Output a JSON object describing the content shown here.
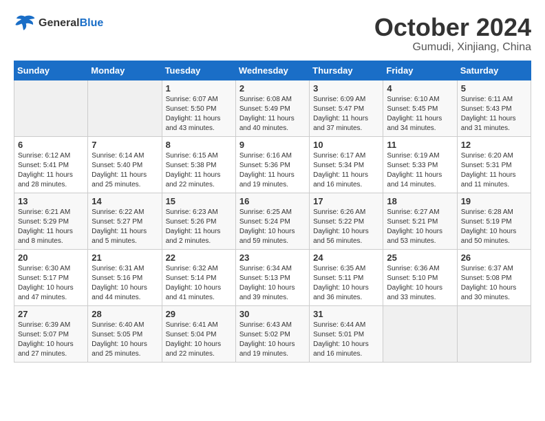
{
  "header": {
    "logo_line1": "General",
    "logo_line2": "Blue",
    "month": "October 2024",
    "location": "Gumudi, Xinjiang, China"
  },
  "days_of_week": [
    "Sunday",
    "Monday",
    "Tuesday",
    "Wednesday",
    "Thursday",
    "Friday",
    "Saturday"
  ],
  "weeks": [
    [
      {
        "num": "",
        "info": ""
      },
      {
        "num": "",
        "info": ""
      },
      {
        "num": "1",
        "info": "Sunrise: 6:07 AM\nSunset: 5:50 PM\nDaylight: 11 hours and 43 minutes."
      },
      {
        "num": "2",
        "info": "Sunrise: 6:08 AM\nSunset: 5:49 PM\nDaylight: 11 hours and 40 minutes."
      },
      {
        "num": "3",
        "info": "Sunrise: 6:09 AM\nSunset: 5:47 PM\nDaylight: 11 hours and 37 minutes."
      },
      {
        "num": "4",
        "info": "Sunrise: 6:10 AM\nSunset: 5:45 PM\nDaylight: 11 hours and 34 minutes."
      },
      {
        "num": "5",
        "info": "Sunrise: 6:11 AM\nSunset: 5:43 PM\nDaylight: 11 hours and 31 minutes."
      }
    ],
    [
      {
        "num": "6",
        "info": "Sunrise: 6:12 AM\nSunset: 5:41 PM\nDaylight: 11 hours and 28 minutes."
      },
      {
        "num": "7",
        "info": "Sunrise: 6:14 AM\nSunset: 5:40 PM\nDaylight: 11 hours and 25 minutes."
      },
      {
        "num": "8",
        "info": "Sunrise: 6:15 AM\nSunset: 5:38 PM\nDaylight: 11 hours and 22 minutes."
      },
      {
        "num": "9",
        "info": "Sunrise: 6:16 AM\nSunset: 5:36 PM\nDaylight: 11 hours and 19 minutes."
      },
      {
        "num": "10",
        "info": "Sunrise: 6:17 AM\nSunset: 5:34 PM\nDaylight: 11 hours and 16 minutes."
      },
      {
        "num": "11",
        "info": "Sunrise: 6:19 AM\nSunset: 5:33 PM\nDaylight: 11 hours and 14 minutes."
      },
      {
        "num": "12",
        "info": "Sunrise: 6:20 AM\nSunset: 5:31 PM\nDaylight: 11 hours and 11 minutes."
      }
    ],
    [
      {
        "num": "13",
        "info": "Sunrise: 6:21 AM\nSunset: 5:29 PM\nDaylight: 11 hours and 8 minutes."
      },
      {
        "num": "14",
        "info": "Sunrise: 6:22 AM\nSunset: 5:27 PM\nDaylight: 11 hours and 5 minutes."
      },
      {
        "num": "15",
        "info": "Sunrise: 6:23 AM\nSunset: 5:26 PM\nDaylight: 11 hours and 2 minutes."
      },
      {
        "num": "16",
        "info": "Sunrise: 6:25 AM\nSunset: 5:24 PM\nDaylight: 10 hours and 59 minutes."
      },
      {
        "num": "17",
        "info": "Sunrise: 6:26 AM\nSunset: 5:22 PM\nDaylight: 10 hours and 56 minutes."
      },
      {
        "num": "18",
        "info": "Sunrise: 6:27 AM\nSunset: 5:21 PM\nDaylight: 10 hours and 53 minutes."
      },
      {
        "num": "19",
        "info": "Sunrise: 6:28 AM\nSunset: 5:19 PM\nDaylight: 10 hours and 50 minutes."
      }
    ],
    [
      {
        "num": "20",
        "info": "Sunrise: 6:30 AM\nSunset: 5:17 PM\nDaylight: 10 hours and 47 minutes."
      },
      {
        "num": "21",
        "info": "Sunrise: 6:31 AM\nSunset: 5:16 PM\nDaylight: 10 hours and 44 minutes."
      },
      {
        "num": "22",
        "info": "Sunrise: 6:32 AM\nSunset: 5:14 PM\nDaylight: 10 hours and 41 minutes."
      },
      {
        "num": "23",
        "info": "Sunrise: 6:34 AM\nSunset: 5:13 PM\nDaylight: 10 hours and 39 minutes."
      },
      {
        "num": "24",
        "info": "Sunrise: 6:35 AM\nSunset: 5:11 PM\nDaylight: 10 hours and 36 minutes."
      },
      {
        "num": "25",
        "info": "Sunrise: 6:36 AM\nSunset: 5:10 PM\nDaylight: 10 hours and 33 minutes."
      },
      {
        "num": "26",
        "info": "Sunrise: 6:37 AM\nSunset: 5:08 PM\nDaylight: 10 hours and 30 minutes."
      }
    ],
    [
      {
        "num": "27",
        "info": "Sunrise: 6:39 AM\nSunset: 5:07 PM\nDaylight: 10 hours and 27 minutes."
      },
      {
        "num": "28",
        "info": "Sunrise: 6:40 AM\nSunset: 5:05 PM\nDaylight: 10 hours and 25 minutes."
      },
      {
        "num": "29",
        "info": "Sunrise: 6:41 AM\nSunset: 5:04 PM\nDaylight: 10 hours and 22 minutes."
      },
      {
        "num": "30",
        "info": "Sunrise: 6:43 AM\nSunset: 5:02 PM\nDaylight: 10 hours and 19 minutes."
      },
      {
        "num": "31",
        "info": "Sunrise: 6:44 AM\nSunset: 5:01 PM\nDaylight: 10 hours and 16 minutes."
      },
      {
        "num": "",
        "info": ""
      },
      {
        "num": "",
        "info": ""
      }
    ]
  ]
}
